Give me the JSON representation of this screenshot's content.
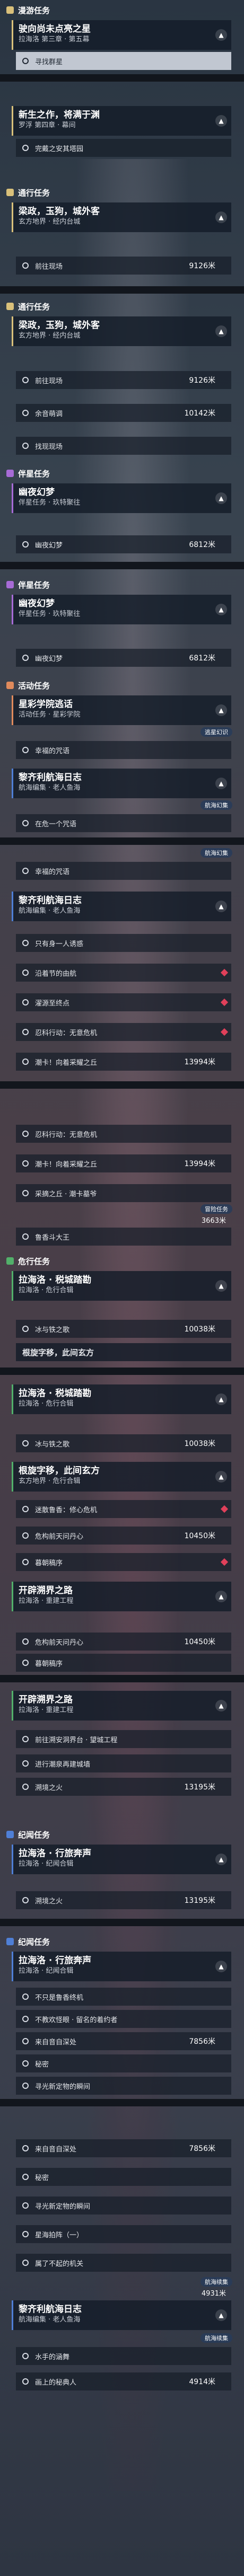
{
  "colors": {
    "mission": "#d9c07a",
    "companion": "#a76bd6",
    "event": "#e08a5c",
    "side": "#52b06a",
    "legend": "#4f7fd6"
  },
  "s1": {
    "section_title": "漫游任务",
    "quest_title": "驶向尚未点亮之星",
    "quest_sub": "拉海洛 第三章 · 第五幕",
    "obj1": "寻找群星"
  },
  "s2": {
    "quest_title": "新生之作，将满于渊",
    "quest_sub": "罗浮 第四章 · 幕间",
    "obj1": "完戴之安其塔园"
  },
  "s3": {
    "section_title": "通行任务",
    "quest_title": "梁政，玉狗，城外客",
    "quest_sub": "玄方地界 · 经内台城",
    "obj1": "前往现场",
    "obj1_dist": "9126米"
  },
  "s4": {
    "section_title": "通行任务",
    "quest_title": "梁政，玉狗，城外客",
    "quest_sub": "玄方地界 · 经内台城",
    "obj1": "前往现场",
    "obj1_dist": "9126米",
    "obj2": "余音萌调",
    "obj2_dist": "10142米",
    "obj3": "找现现场"
  },
  "s5": {
    "section_title": "伴星任务",
    "quest_title": "幽夜幻梦",
    "quest_sub": "伴星任务 · 玖特聚往",
    "obj1": "幽夜幻梦",
    "obj1_dist": "6812米"
  },
  "s6": {
    "section_title": "伴星任务",
    "quest_title": "幽夜幻梦",
    "quest_sub": "伴星任务 · 玖特聚往",
    "obj1": "幽夜幻梦",
    "obj1_dist": "6812米"
  },
  "s7": {
    "section_title": "活动任务",
    "quest_title": "星彩学院逃话",
    "quest_sub": "活动任务 · 星彩学院",
    "badge": "逃星幻识",
    "obj1": "幸福的咒语"
  },
  "s8": {
    "quest_title": "黎齐利航海日志",
    "quest_sub": "航海编集 · 老人鱼海",
    "badge": "航海幻集",
    "obj1": "在危一个咒语"
  },
  "s9": {
    "badge": "航海幻集",
    "obj1": "幸福的咒语",
    "quest_title": "黎齐利航海日志",
    "quest_sub": "航海编集 · 老人鱼海",
    "obj2": "只有身一人诱惑",
    "obj3": "沿着节的由航",
    "obj4": "濯源至终点",
    "obj5": "忍科行动：无意危机",
    "obj6": "潮卡！向着采耀之丘",
    "obj6_dist": "13994米"
  },
  "s10": {
    "obj1": "忍科行动：无意危机",
    "obj2": "潮卡！向着采耀之丘",
    "obj2_dist": "13994米",
    "obj3": "采摘之丘 · 潮卡墓爷",
    "badge": "冒险任务",
    "badge_dist": "3663米",
    "obj4": "鲁香斗大王"
  },
  "s11": {
    "section_title": "危行任务",
    "quest_title": "拉海洛 · 税城踏勘",
    "quest_sub": "拉海洛 · 危行合辑",
    "obj1": "冰与铁之歌",
    "obj1_dist": "10038米",
    "obj2": "根旋字移，此间玄方"
  },
  "s12": {
    "quest_title": "拉海洛 · 税城踏勘",
    "quest_sub": "拉海洛 · 危行合辑",
    "obj1": "冰与铁之歌",
    "obj1_dist": "10038米"
  },
  "s13": {
    "quest_title": "根旋字移，此间玄方",
    "quest_sub": "玄方地界 · 危行合辑",
    "obj1": "迷散鲁香：修心危机",
    "obj2": "危构前天问丹心",
    "obj2_dist": "10450米",
    "obj3": "暮朝稿序"
  },
  "s14": {
    "quest_title": "开辟溯界之路",
    "quest_sub": "拉海洛 · 重建工程",
    "obj1": "危构前天问丹心",
    "obj1_dist": "10450米",
    "obj2": "暮朝稿序"
  },
  "s15": {
    "quest_title": "开辟溯界之路",
    "quest_sub": "拉海洛 · 重建工程",
    "obj1": "前往溯安洞界台 · 望城工程",
    "obj2": "进行潮泉再建城墙",
    "obj3": "溯境之火",
    "obj3_dist": "13195米"
  },
  "s16": {
    "section_title": "纪闻任务",
    "quest_title": "拉海洛 · 行旅奔声",
    "quest_sub": "拉海洛 · 纪闻合辑",
    "obj1": "溯境之火",
    "obj1_dist": "13195米"
  },
  "s17": {
    "section_title": "纪闻任务",
    "quest_title": "拉海洛 · 行旅奔声",
    "quest_sub": "拉海洛 · 纪闻合辑",
    "obj1": "不只是鲁香终机",
    "obj2": "不教欢怪眼 · 留名的着约者",
    "obj3": "来自音自深处",
    "obj3_dist": "7856米",
    "obj4": "秘密",
    "obj5": "寻光新定物的瞬间"
  },
  "s18": {
    "obj1": "来自音自深处",
    "obj1_dist": "7856米",
    "obj2": "秘密",
    "obj3": "寻光新定物的瞬间",
    "obj4": "星海拍阵（一）",
    "obj5": "属了不起的机关",
    "badge1": "航海续集",
    "badge1_dist": "4931米",
    "quest_title": "黎齐利航海日志",
    "quest_sub": "航海编集 · 老人鱼海",
    "badge2": "航海续集",
    "obj6": "水手的涵舞",
    "obj7": "画上的秘典人",
    "obj7_dist": "4914米"
  },
  "icons": [
    "chevron-up-icon",
    "ring-icon",
    "diamond-marker-icon",
    "section-icon"
  ]
}
